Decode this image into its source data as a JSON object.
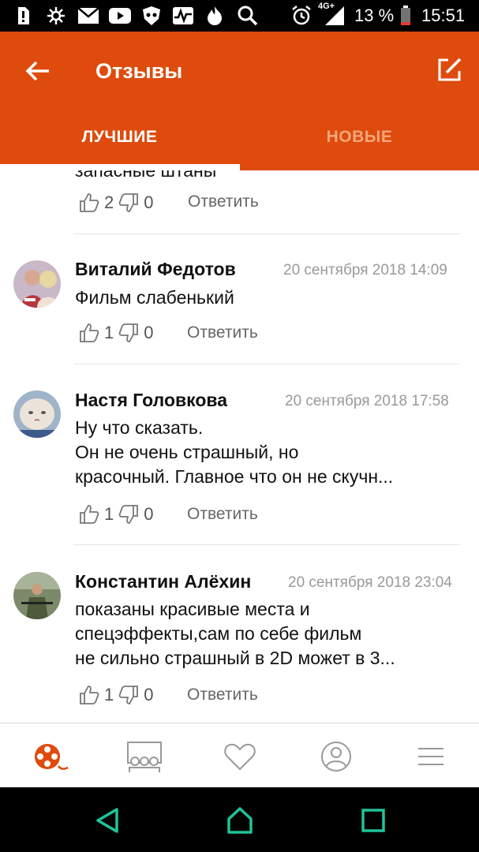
{
  "status_bar": {
    "icons": [
      "sim-alert-icon",
      "settings-icon",
      "mail-icon",
      "youtube-icon",
      "shield-icon",
      "activity-icon",
      "flame-icon",
      "search-icon",
      "alarm-icon"
    ],
    "network": "4G+",
    "battery": "13 %",
    "time": "15:51"
  },
  "header": {
    "title": "Отзывы",
    "back_icon": "arrow-left-icon",
    "edit_icon": "edit-icon"
  },
  "tabs": [
    {
      "label": "ЛУЧШИЕ",
      "active": true
    },
    {
      "label": "НОВЫЕ",
      "active": false
    }
  ],
  "partial_comment": {
    "text": "запасные штаны",
    "likes": "2",
    "dislikes": "0",
    "reply_label": "Ответить"
  },
  "comments": [
    {
      "author": "Виталий Федотов",
      "date": "20 сентября 2018 14:09",
      "lines": [
        "Фильм слабенький"
      ],
      "likes": "1",
      "dislikes": "0",
      "reply_label": "Ответить"
    },
    {
      "author": "Настя Головкова",
      "date": "20 сентября 2018 17:58",
      "lines": [
        "Ну что сказать.",
        "Он не очень страшный, но",
        "красочный. Главное что он не скучн..."
      ],
      "likes": "1",
      "dislikes": "0",
      "reply_label": "Ответить"
    },
    {
      "author": "Константин Алёхин",
      "date": "20 сентября 2018 23:04",
      "lines": [
        "показаны красивые места и",
        "спецэффекты,сам по себе фильм",
        "не сильно страшный в 2D может в 3..."
      ],
      "likes": "1",
      "dislikes": "0",
      "reply_label": "Ответить"
    }
  ],
  "bottom_nav": [
    {
      "icon": "film-reel-icon",
      "active": true
    },
    {
      "icon": "cinema-icon",
      "active": false
    },
    {
      "icon": "heart-icon",
      "active": false
    },
    {
      "icon": "profile-icon",
      "active": false
    },
    {
      "icon": "menu-icon",
      "active": false
    }
  ],
  "colors": {
    "accent": "#de4b0c",
    "tab_inactive": "#f5a57a",
    "system_nav_icons": "#1fc39a"
  }
}
